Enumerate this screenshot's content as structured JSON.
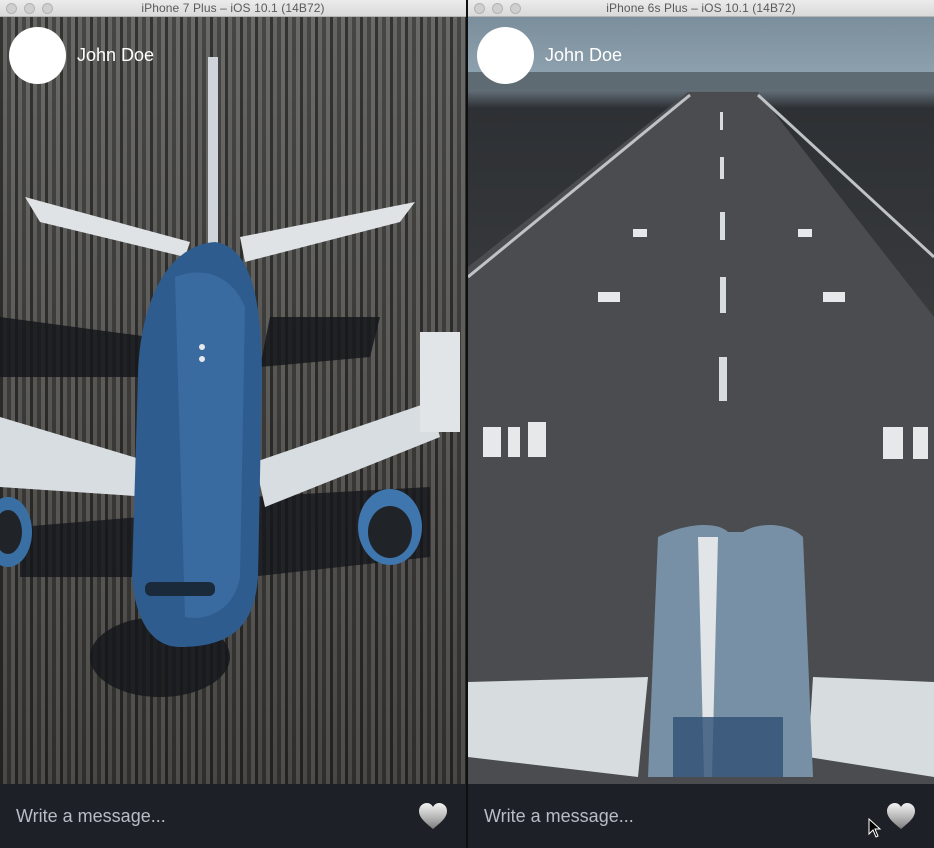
{
  "simulators": [
    {
      "title": "iPhone 7 Plus – iOS 10.1 (14B72)",
      "user_name": "John Doe",
      "message_placeholder": "Write a message..."
    },
    {
      "title": "iPhone 6s Plus – iOS 10.1 (14B72)",
      "user_name": "John Doe",
      "message_placeholder": "Write a message..."
    }
  ],
  "icons": {
    "heart": "heart-icon",
    "avatar": "avatar",
    "cursor": "mouse-pointer-icon"
  },
  "colors": {
    "bottom_bar": "#1d2027",
    "plane_body": "#2f5c8e",
    "placeholder_text": "#b8bcc4"
  }
}
